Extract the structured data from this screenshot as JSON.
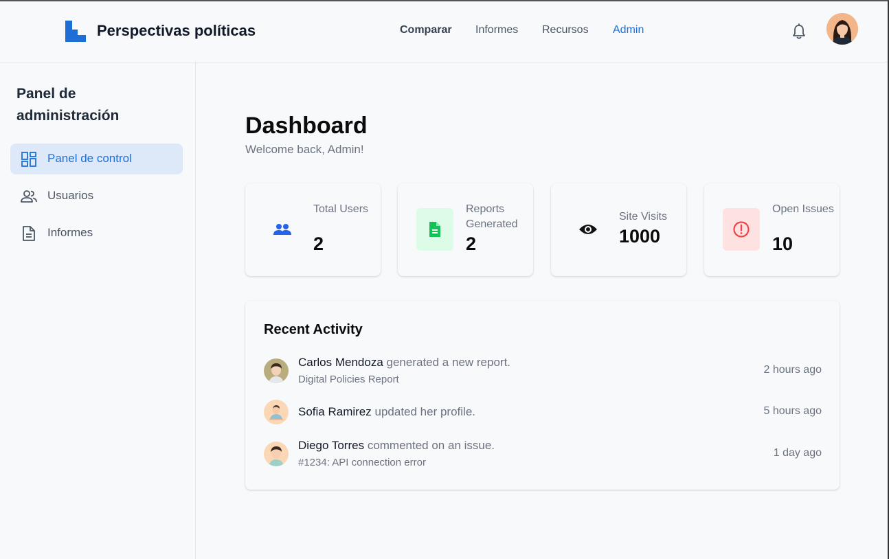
{
  "header": {
    "brand": "Perspectivas políticas",
    "nav": [
      {
        "label": "Comparar"
      },
      {
        "label": "Informes"
      },
      {
        "label": "Recursos"
      },
      {
        "label": "Admin"
      }
    ],
    "accent_color": "#1d6fd6"
  },
  "sidebar": {
    "title": "Panel de administración",
    "items": [
      {
        "label": "Panel de control",
        "icon": "dashboard-icon",
        "active": true
      },
      {
        "label": "Usuarios",
        "icon": "users-icon"
      },
      {
        "label": "Informes",
        "icon": "document-icon"
      }
    ]
  },
  "main": {
    "title": "Dashboard",
    "subtitle": "Welcome back, Admin!",
    "stats": [
      {
        "label": "Total Users",
        "value": "2",
        "icon": "users-icon",
        "color": "#2563eb"
      },
      {
        "label": "Reports Generated",
        "value": "2",
        "icon": "document-icon",
        "color": "#16c157"
      },
      {
        "label": "Site Visits",
        "value": "1000",
        "icon": "eye-icon",
        "color": "#111111"
      },
      {
        "label": "Open Issues",
        "value": "10",
        "icon": "alert-icon",
        "color": "#ef4444"
      }
    ],
    "activity": {
      "title": "Recent Activity",
      "items": [
        {
          "name": "Carlos Mendoza",
          "action": "generated a new report.",
          "detail": "Digital Policies Report",
          "time": "2 hours ago"
        },
        {
          "name": "Sofia Ramirez",
          "action": "updated her profile.",
          "detail": "",
          "time": "5 hours ago"
        },
        {
          "name": "Diego Torres",
          "action": "commented on an issue.",
          "detail": "#1234: API connection error",
          "time": "1 day ago"
        }
      ]
    }
  }
}
